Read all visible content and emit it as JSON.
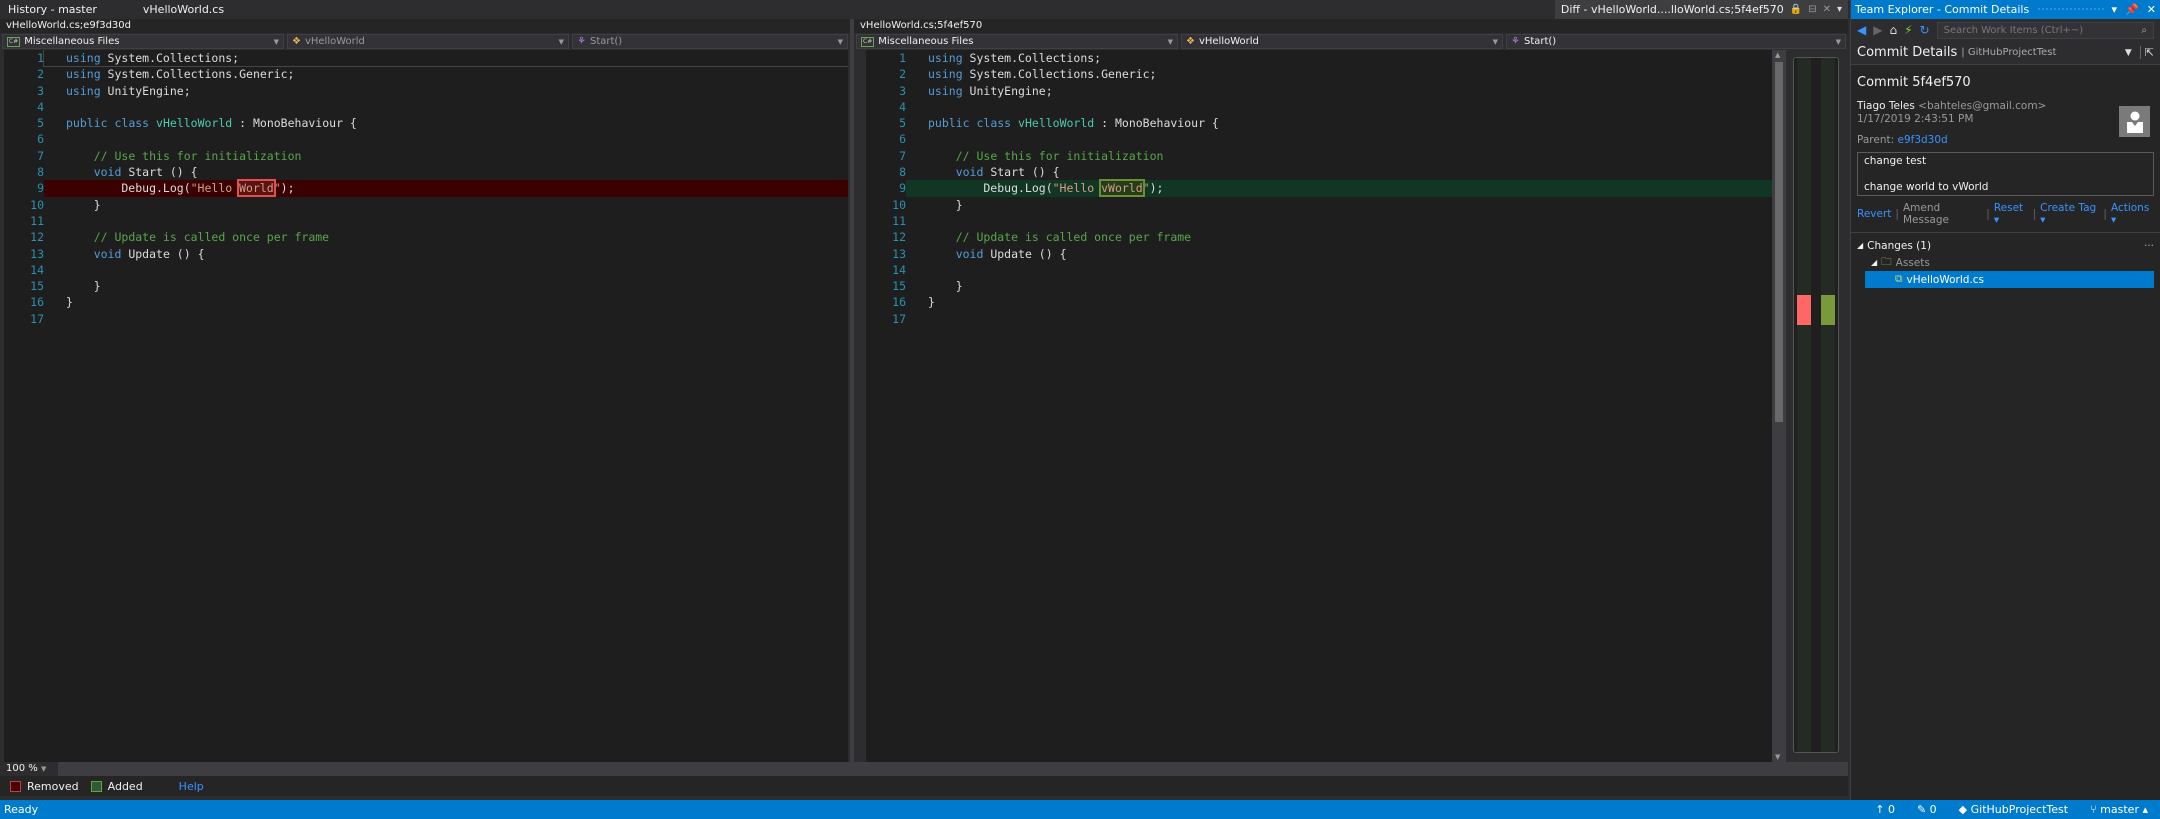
{
  "tabs": {
    "history": "History - master",
    "file": "vHelloWorld.cs",
    "diff": "Diff - vHelloWorld....lloWorld.cs;5f4ef570"
  },
  "left": {
    "path": "vHelloWorld.cs;e9f3d30d",
    "project": "Miscellaneous Files",
    "class": "vHelloWorld",
    "member": "Start()",
    "lines": [
      [
        {
          "c": "kw",
          "t": "using"
        },
        {
          "c": "pl",
          "t": " System.Collections;"
        }
      ],
      [
        {
          "c": "kw",
          "t": "using"
        },
        {
          "c": "pl",
          "t": " System.Collections.Generic;"
        }
      ],
      [
        {
          "c": "kw",
          "t": "using"
        },
        {
          "c": "pl",
          "t": " UnityEngine;"
        }
      ],
      [],
      [
        {
          "c": "kw",
          "t": "public"
        },
        {
          "c": "pl",
          "t": " "
        },
        {
          "c": "kw",
          "t": "class"
        },
        {
          "c": "pl",
          "t": " "
        },
        {
          "c": "ty",
          "t": "vHelloWorld"
        },
        {
          "c": "pl",
          "t": " : MonoBehaviour {"
        }
      ],
      [],
      [
        {
          "c": "pl",
          "t": "    "
        },
        {
          "c": "cm",
          "t": "// Use this for initialization"
        }
      ],
      [
        {
          "c": "pl",
          "t": "    "
        },
        {
          "c": "kw",
          "t": "void"
        },
        {
          "c": "pl",
          "t": " Start () {"
        }
      ],
      [
        {
          "c": "pl",
          "t": "        Debug.Log("
        },
        {
          "c": "st",
          "t": "\"Hello "
        },
        {
          "c": "st hl-rem",
          "t": "World"
        },
        {
          "c": "st",
          "t": "\""
        },
        {
          "c": "pl",
          "t": ");"
        }
      ],
      [
        {
          "c": "pl",
          "t": "    }"
        }
      ],
      [],
      [
        {
          "c": "pl",
          "t": "    "
        },
        {
          "c": "cm",
          "t": "// Update is called once per frame"
        }
      ],
      [
        {
          "c": "pl",
          "t": "    "
        },
        {
          "c": "kw",
          "t": "void"
        },
        {
          "c": "pl",
          "t": " Update () {"
        }
      ],
      [],
      [
        {
          "c": "pl",
          "t": "    }"
        }
      ],
      [
        {
          "c": "pl",
          "t": "}"
        }
      ],
      []
    ]
  },
  "right": {
    "path": "vHelloWorld.cs;5f4ef570",
    "project": "Miscellaneous Files",
    "class": "vHelloWorld",
    "member": "Start()",
    "lines": [
      [
        {
          "c": "kw",
          "t": "using"
        },
        {
          "c": "pl",
          "t": " System.Collections;"
        }
      ],
      [
        {
          "c": "kw",
          "t": "using"
        },
        {
          "c": "pl",
          "t": " System.Collections.Generic;"
        }
      ],
      [
        {
          "c": "kw",
          "t": "using"
        },
        {
          "c": "pl",
          "t": " UnityEngine;"
        }
      ],
      [],
      [
        {
          "c": "kw",
          "t": "public"
        },
        {
          "c": "pl",
          "t": " "
        },
        {
          "c": "kw",
          "t": "class"
        },
        {
          "c": "pl",
          "t": " "
        },
        {
          "c": "ty",
          "t": "vHelloWorld"
        },
        {
          "c": "pl",
          "t": " : MonoBehaviour {"
        }
      ],
      [],
      [
        {
          "c": "pl",
          "t": "    "
        },
        {
          "c": "cm",
          "t": "// Use this for initialization"
        }
      ],
      [
        {
          "c": "pl",
          "t": "    "
        },
        {
          "c": "kw",
          "t": "void"
        },
        {
          "c": "pl",
          "t": " Start () {"
        }
      ],
      [
        {
          "c": "pl",
          "t": "        Debug.Log("
        },
        {
          "c": "st",
          "t": "\"Hello "
        },
        {
          "c": "st hl-add",
          "t": "vWorld"
        },
        {
          "c": "st",
          "t": "\""
        },
        {
          "c": "pl",
          "t": ");"
        }
      ],
      [
        {
          "c": "pl",
          "t": "    }"
        }
      ],
      [],
      [
        {
          "c": "pl",
          "t": "    "
        },
        {
          "c": "cm",
          "t": "// Update is called once per frame"
        }
      ],
      [
        {
          "c": "pl",
          "t": "    "
        },
        {
          "c": "kw",
          "t": "void"
        },
        {
          "c": "pl",
          "t": " Update () {"
        }
      ],
      [],
      [
        {
          "c": "pl",
          "t": "    }"
        }
      ],
      [
        {
          "c": "pl",
          "t": "}"
        }
      ],
      []
    ]
  },
  "changed_line": 9,
  "zoom": "100 %",
  "legend": {
    "removed": "Removed",
    "added": "Added",
    "help": "Help"
  },
  "team_explorer": {
    "title": "Team Explorer - Commit Details",
    "search_placeholder": "Search Work Items (Ctrl+~)",
    "section": "Commit Details",
    "repo": "GitHubProjectTest",
    "commit_label": "Commit 5f4ef570",
    "author": "Tiago Teles",
    "email": "<bahteles@gmail.com>",
    "date": "1/17/2019 2:43:51 PM",
    "parent_label": "Parent:",
    "parent": "e9f3d30d",
    "message_title": "change test",
    "message_body": "change world to vWorld",
    "actions": [
      "Revert",
      "Amend Message",
      "Reset",
      "Create Tag",
      "Actions"
    ],
    "changes_label": "Changes (1)",
    "folder": "Assets",
    "file": "vHelloWorld.cs"
  },
  "status": {
    "ready": "Ready",
    "up": "0",
    "edits": "0",
    "repo": "GitHubProjectTest",
    "branch": "master"
  },
  "colors": {
    "accent": "#007acc",
    "removed": "#ff6666",
    "added": "#7a9a3a"
  }
}
